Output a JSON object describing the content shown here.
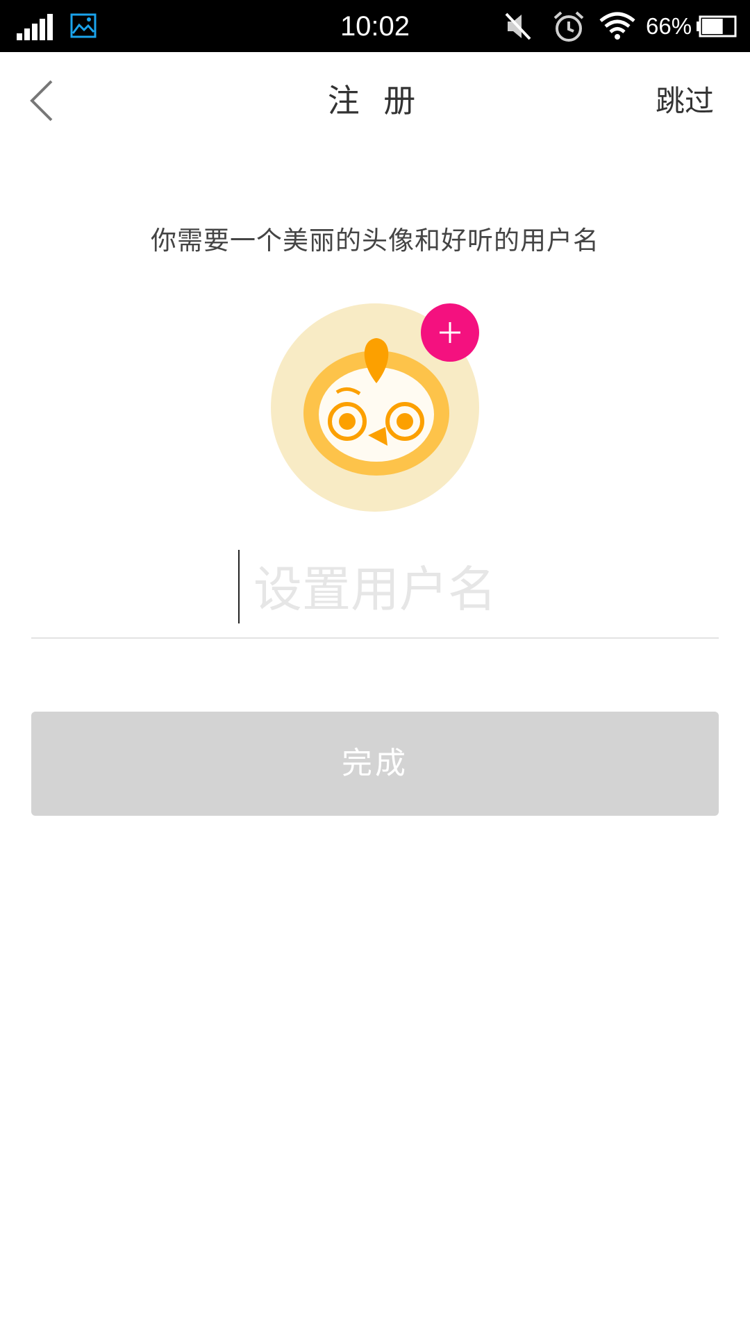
{
  "status_bar": {
    "time": "10:02",
    "battery_percent": "66%",
    "battery_level": 0.66,
    "icons": [
      "signal-icon",
      "gallery-icon",
      "mute-icon",
      "alarm-icon",
      "wifi-icon",
      "battery-icon"
    ]
  },
  "header": {
    "title": "注 册",
    "skip_label": "跳过"
  },
  "main": {
    "subtitle": "你需要一个美丽的头像和好听的用户名",
    "username": {
      "value": "",
      "placeholder": "设置用户名"
    },
    "done_label": "完成"
  },
  "colors": {
    "add_button": "#f4117f",
    "avatar_bg": "#f8ebc5",
    "avatar_accent": "#fca000",
    "button_disabled": "#d3d3d3"
  }
}
